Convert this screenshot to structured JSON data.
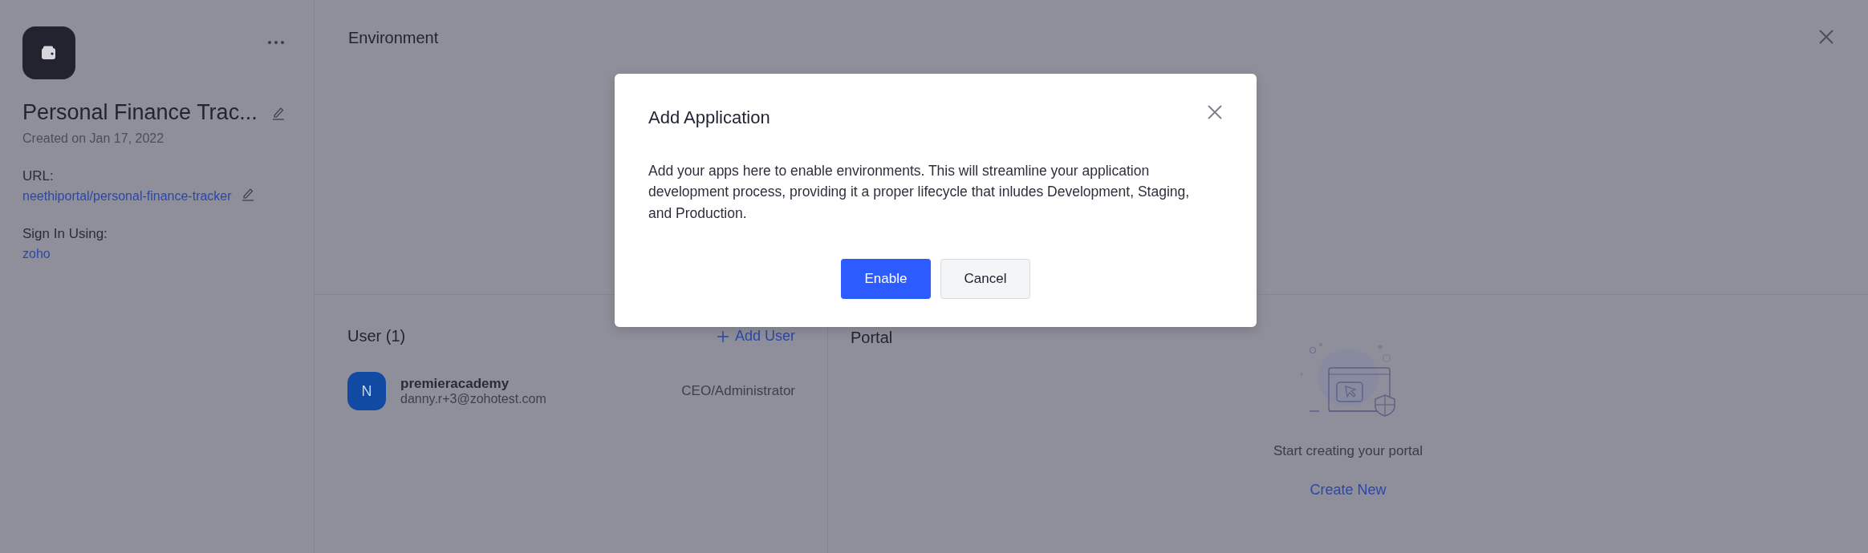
{
  "app": {
    "name": "Personal Finance Trac...",
    "created": "Created on Jan 17, 2022",
    "url_label": "URL:",
    "url": "neethiportal/personal-finance-tracker",
    "sign_in_label": "Sign In Using:",
    "sign_in": "zoho"
  },
  "environment": {
    "title": "Environment"
  },
  "users": {
    "title": "User (1)",
    "add_button": "Add User",
    "rows": [
      {
        "initial": "N",
        "name": "premieracademy",
        "email": "danny.r+3@zohotest.com",
        "role": "CEO/Administrator"
      }
    ]
  },
  "portal": {
    "title": "Portal",
    "message": "Start creating your portal",
    "action": "Create New"
  },
  "dialog": {
    "title": "Add Application",
    "body": "Add your apps here to enable environments. This will streamline your application development process, providing it a proper lifecycle that inludes Development, Staging, and Production.",
    "buttons": [
      {
        "label": "Enable",
        "kind": "primary"
      },
      {
        "label": "Cancel",
        "kind": "secondary"
      }
    ]
  }
}
